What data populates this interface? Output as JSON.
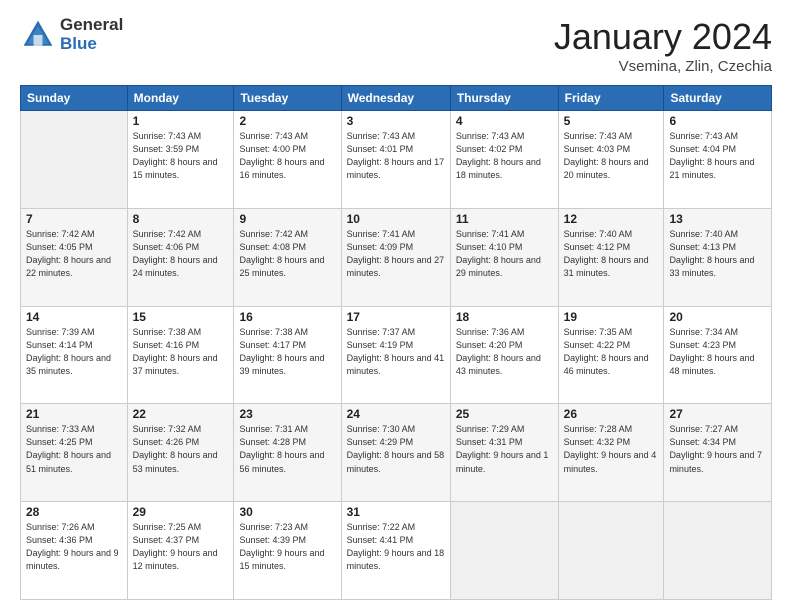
{
  "header": {
    "logo_general": "General",
    "logo_blue": "Blue",
    "month_title": "January 2024",
    "location": "Vsemina, Zlin, Czechia"
  },
  "days_of_week": [
    "Sunday",
    "Monday",
    "Tuesday",
    "Wednesday",
    "Thursday",
    "Friday",
    "Saturday"
  ],
  "weeks": [
    [
      {
        "day": "",
        "sunrise": "",
        "sunset": "",
        "daylight": ""
      },
      {
        "day": "1",
        "sunrise": "Sunrise: 7:43 AM",
        "sunset": "Sunset: 3:59 PM",
        "daylight": "Daylight: 8 hours and 15 minutes."
      },
      {
        "day": "2",
        "sunrise": "Sunrise: 7:43 AM",
        "sunset": "Sunset: 4:00 PM",
        "daylight": "Daylight: 8 hours and 16 minutes."
      },
      {
        "day": "3",
        "sunrise": "Sunrise: 7:43 AM",
        "sunset": "Sunset: 4:01 PM",
        "daylight": "Daylight: 8 hours and 17 minutes."
      },
      {
        "day": "4",
        "sunrise": "Sunrise: 7:43 AM",
        "sunset": "Sunset: 4:02 PM",
        "daylight": "Daylight: 8 hours and 18 minutes."
      },
      {
        "day": "5",
        "sunrise": "Sunrise: 7:43 AM",
        "sunset": "Sunset: 4:03 PM",
        "daylight": "Daylight: 8 hours and 20 minutes."
      },
      {
        "day": "6",
        "sunrise": "Sunrise: 7:43 AM",
        "sunset": "Sunset: 4:04 PM",
        "daylight": "Daylight: 8 hours and 21 minutes."
      }
    ],
    [
      {
        "day": "7",
        "sunrise": "Sunrise: 7:42 AM",
        "sunset": "Sunset: 4:05 PM",
        "daylight": "Daylight: 8 hours and 22 minutes."
      },
      {
        "day": "8",
        "sunrise": "Sunrise: 7:42 AM",
        "sunset": "Sunset: 4:06 PM",
        "daylight": "Daylight: 8 hours and 24 minutes."
      },
      {
        "day": "9",
        "sunrise": "Sunrise: 7:42 AM",
        "sunset": "Sunset: 4:08 PM",
        "daylight": "Daylight: 8 hours and 25 minutes."
      },
      {
        "day": "10",
        "sunrise": "Sunrise: 7:41 AM",
        "sunset": "Sunset: 4:09 PM",
        "daylight": "Daylight: 8 hours and 27 minutes."
      },
      {
        "day": "11",
        "sunrise": "Sunrise: 7:41 AM",
        "sunset": "Sunset: 4:10 PM",
        "daylight": "Daylight: 8 hours and 29 minutes."
      },
      {
        "day": "12",
        "sunrise": "Sunrise: 7:40 AM",
        "sunset": "Sunset: 4:12 PM",
        "daylight": "Daylight: 8 hours and 31 minutes."
      },
      {
        "day": "13",
        "sunrise": "Sunrise: 7:40 AM",
        "sunset": "Sunset: 4:13 PM",
        "daylight": "Daylight: 8 hours and 33 minutes."
      }
    ],
    [
      {
        "day": "14",
        "sunrise": "Sunrise: 7:39 AM",
        "sunset": "Sunset: 4:14 PM",
        "daylight": "Daylight: 8 hours and 35 minutes."
      },
      {
        "day": "15",
        "sunrise": "Sunrise: 7:38 AM",
        "sunset": "Sunset: 4:16 PM",
        "daylight": "Daylight: 8 hours and 37 minutes."
      },
      {
        "day": "16",
        "sunrise": "Sunrise: 7:38 AM",
        "sunset": "Sunset: 4:17 PM",
        "daylight": "Daylight: 8 hours and 39 minutes."
      },
      {
        "day": "17",
        "sunrise": "Sunrise: 7:37 AM",
        "sunset": "Sunset: 4:19 PM",
        "daylight": "Daylight: 8 hours and 41 minutes."
      },
      {
        "day": "18",
        "sunrise": "Sunrise: 7:36 AM",
        "sunset": "Sunset: 4:20 PM",
        "daylight": "Daylight: 8 hours and 43 minutes."
      },
      {
        "day": "19",
        "sunrise": "Sunrise: 7:35 AM",
        "sunset": "Sunset: 4:22 PM",
        "daylight": "Daylight: 8 hours and 46 minutes."
      },
      {
        "day": "20",
        "sunrise": "Sunrise: 7:34 AM",
        "sunset": "Sunset: 4:23 PM",
        "daylight": "Daylight: 8 hours and 48 minutes."
      }
    ],
    [
      {
        "day": "21",
        "sunrise": "Sunrise: 7:33 AM",
        "sunset": "Sunset: 4:25 PM",
        "daylight": "Daylight: 8 hours and 51 minutes."
      },
      {
        "day": "22",
        "sunrise": "Sunrise: 7:32 AM",
        "sunset": "Sunset: 4:26 PM",
        "daylight": "Daylight: 8 hours and 53 minutes."
      },
      {
        "day": "23",
        "sunrise": "Sunrise: 7:31 AM",
        "sunset": "Sunset: 4:28 PM",
        "daylight": "Daylight: 8 hours and 56 minutes."
      },
      {
        "day": "24",
        "sunrise": "Sunrise: 7:30 AM",
        "sunset": "Sunset: 4:29 PM",
        "daylight": "Daylight: 8 hours and 58 minutes."
      },
      {
        "day": "25",
        "sunrise": "Sunrise: 7:29 AM",
        "sunset": "Sunset: 4:31 PM",
        "daylight": "Daylight: 9 hours and 1 minute."
      },
      {
        "day": "26",
        "sunrise": "Sunrise: 7:28 AM",
        "sunset": "Sunset: 4:32 PM",
        "daylight": "Daylight: 9 hours and 4 minutes."
      },
      {
        "day": "27",
        "sunrise": "Sunrise: 7:27 AM",
        "sunset": "Sunset: 4:34 PM",
        "daylight": "Daylight: 9 hours and 7 minutes."
      }
    ],
    [
      {
        "day": "28",
        "sunrise": "Sunrise: 7:26 AM",
        "sunset": "Sunset: 4:36 PM",
        "daylight": "Daylight: 9 hours and 9 minutes."
      },
      {
        "day": "29",
        "sunrise": "Sunrise: 7:25 AM",
        "sunset": "Sunset: 4:37 PM",
        "daylight": "Daylight: 9 hours and 12 minutes."
      },
      {
        "day": "30",
        "sunrise": "Sunrise: 7:23 AM",
        "sunset": "Sunset: 4:39 PM",
        "daylight": "Daylight: 9 hours and 15 minutes."
      },
      {
        "day": "31",
        "sunrise": "Sunrise: 7:22 AM",
        "sunset": "Sunset: 4:41 PM",
        "daylight": "Daylight: 9 hours and 18 minutes."
      },
      {
        "day": "",
        "sunrise": "",
        "sunset": "",
        "daylight": ""
      },
      {
        "day": "",
        "sunrise": "",
        "sunset": "",
        "daylight": ""
      },
      {
        "day": "",
        "sunrise": "",
        "sunset": "",
        "daylight": ""
      }
    ]
  ]
}
